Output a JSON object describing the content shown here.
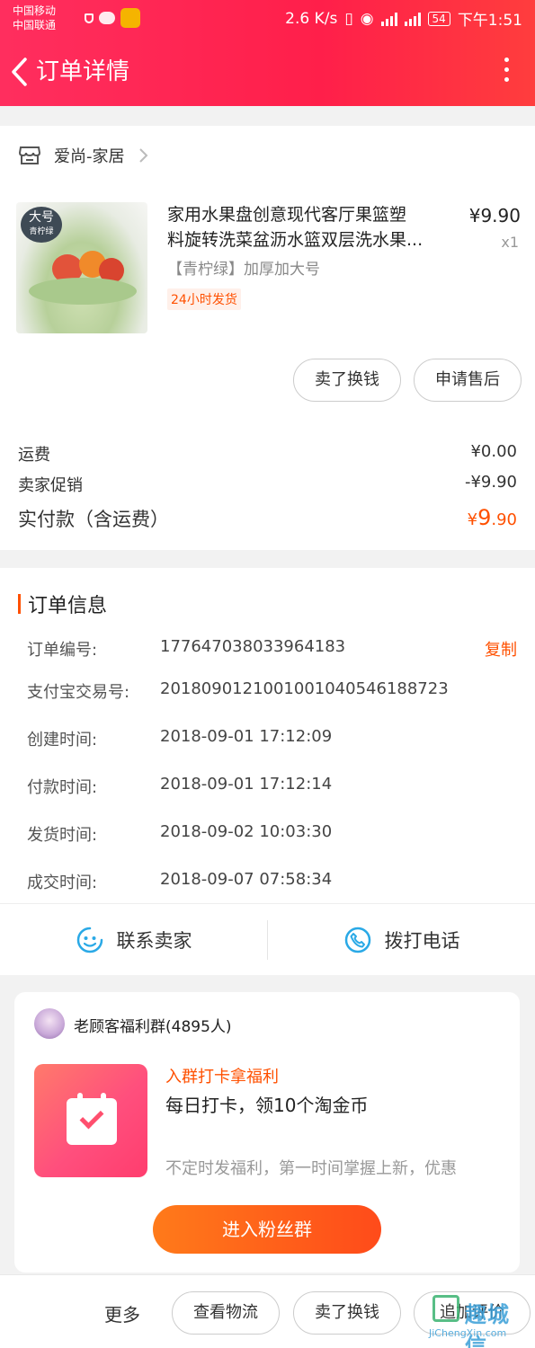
{
  "status_bar": {
    "carrier_1": "中国移动",
    "carrier_2": "中国联通",
    "net_speed": "2.6 K/s",
    "battery": "54",
    "time": "下午1:51"
  },
  "nav": {
    "title": "订单详情"
  },
  "shop": {
    "name": "爱尚-家居"
  },
  "goods": {
    "image_tag_main": "大号",
    "image_tag_sub": "青柠绿",
    "title_line1": "家用水果盘创意现代客厅果篮塑",
    "title_line2": "料旋转洗菜盆沥水篮双层洗水果...",
    "price": "¥9.90",
    "qty": "x1",
    "sku": "【青柠绿】加厚加大号",
    "badge": "24小时发货",
    "btn_sell": "卖了换钱",
    "btn_aftersale": "申请售后"
  },
  "fees": {
    "shipping_label": "运费",
    "shipping_value": "¥0.00",
    "promo_label": "卖家促销",
    "promo_value": "-¥9.90",
    "paid_label": "实付款（含运费）",
    "paid_currency": "¥",
    "paid_int": "9",
    "paid_dec": ".90"
  },
  "order_info": {
    "heading": "订单信息",
    "copy_label": "复制",
    "rows": [
      {
        "label": "订单编号:",
        "value": "177647038033964183"
      },
      {
        "label": "支付宝交易号:",
        "value": "2018090121001001040546188723"
      },
      {
        "label": "创建时间:",
        "value": "2018-09-01 17:12:09"
      },
      {
        "label": "付款时间:",
        "value": "2018-09-01 17:12:14"
      },
      {
        "label": "发货时间:",
        "value": "2018-09-02 10:03:30"
      },
      {
        "label": "成交时间:",
        "value": "2018-09-07 07:58:34"
      }
    ]
  },
  "contact": {
    "seller": "联系卖家",
    "phone": "拨打电话"
  },
  "fans_group": {
    "name": "老顾客福利群(4895人)",
    "promo_title": "入群打卡拿福利",
    "promo_sub": "每日打卡，领10个淘金币",
    "promo_desc": "不定时发福利，第一时间掌握上新，优惠",
    "join_button": "进入粉丝群"
  },
  "bottom_bar": {
    "more": "更多",
    "logistics": "查看物流",
    "sell": "卖了换钱",
    "review": "追加评价"
  },
  "watermark": {
    "text": "趣城信",
    "url": "JiChengXin.com"
  },
  "colors": {
    "accent": "#ff5000",
    "header": "#ff2e5e",
    "contact_icon": "#2aa9e6"
  }
}
